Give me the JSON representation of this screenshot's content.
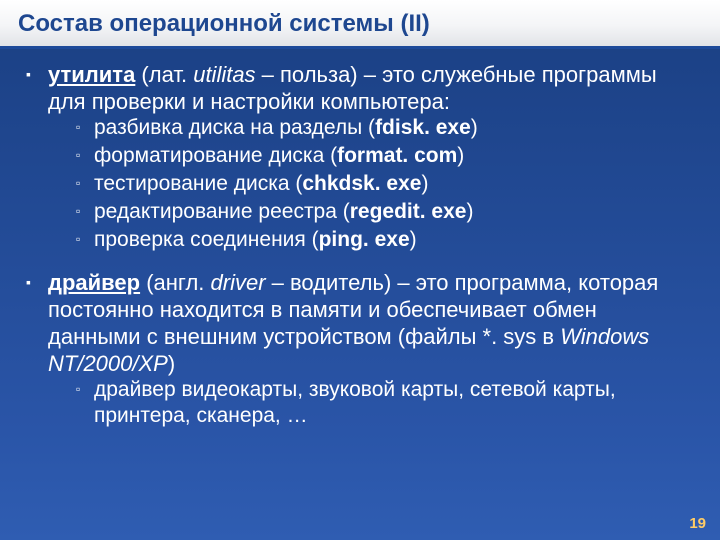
{
  "title": "Состав операционной системы (II)",
  "items": [
    {
      "lead": {
        "term": "утилита",
        "rest1": " (лат. ",
        "latin": "utilitas",
        "rest2": " – польза) – это служебные программы для проверки и настройки компьютера:"
      },
      "subs": [
        {
          "t1": "разбивка диска на разделы (",
          "prog": "fdisk. exe",
          "t2": ")"
        },
        {
          "t1": "форматирование диска (",
          "prog": "format. com",
          "t2": ")"
        },
        {
          "t1": "тестирование диска (",
          "prog": "chkdsk. exe",
          "t2": ")"
        },
        {
          "t1": "редактирование реестра (",
          "prog": "regedit. exe",
          "t2": ")"
        },
        {
          "t1": "проверка соединения (",
          "prog": "ping. exe",
          "t2": ")"
        }
      ]
    },
    {
      "lead": {
        "term": "драйвер",
        "rest1": " (англ. ",
        "latin": "driver",
        "rest2": " – водитель) – это программа, которая постоянно находится в памяти и обеспечивает обмен данными с внешним устройством (файлы *. sys в ",
        "italic_tail": "Windows NT/2000/XP",
        "rest3": ")"
      },
      "subs": [
        {
          "t1": "драйвер видеокарты, звуковой карты, сетевой карты, принтера, сканера, …",
          "prog": "",
          "t2": ""
        }
      ]
    }
  ],
  "page_number": "19",
  "marks": {
    "level1": "▪",
    "level2": "▫"
  }
}
